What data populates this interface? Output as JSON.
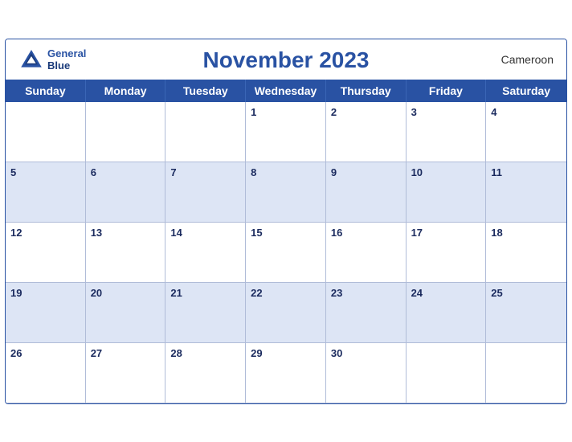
{
  "header": {
    "title": "November 2023",
    "country": "Cameroon",
    "logo_line1": "General",
    "logo_line2": "Blue"
  },
  "days": [
    "Sunday",
    "Monday",
    "Tuesday",
    "Wednesday",
    "Thursday",
    "Friday",
    "Saturday"
  ],
  "weeks": [
    [
      {
        "date": "",
        "row": "odd"
      },
      {
        "date": "",
        "row": "odd"
      },
      {
        "date": "",
        "row": "odd"
      },
      {
        "date": "1",
        "row": "odd"
      },
      {
        "date": "2",
        "row": "odd"
      },
      {
        "date": "3",
        "row": "odd"
      },
      {
        "date": "4",
        "row": "odd"
      }
    ],
    [
      {
        "date": "5",
        "row": "even"
      },
      {
        "date": "6",
        "row": "even"
      },
      {
        "date": "7",
        "row": "even"
      },
      {
        "date": "8",
        "row": "even"
      },
      {
        "date": "9",
        "row": "even"
      },
      {
        "date": "10",
        "row": "even"
      },
      {
        "date": "11",
        "row": "even"
      }
    ],
    [
      {
        "date": "12",
        "row": "odd"
      },
      {
        "date": "13",
        "row": "odd"
      },
      {
        "date": "14",
        "row": "odd"
      },
      {
        "date": "15",
        "row": "odd"
      },
      {
        "date": "16",
        "row": "odd"
      },
      {
        "date": "17",
        "row": "odd"
      },
      {
        "date": "18",
        "row": "odd"
      }
    ],
    [
      {
        "date": "19",
        "row": "even"
      },
      {
        "date": "20",
        "row": "even"
      },
      {
        "date": "21",
        "row": "even"
      },
      {
        "date": "22",
        "row": "even"
      },
      {
        "date": "23",
        "row": "even"
      },
      {
        "date": "24",
        "row": "even"
      },
      {
        "date": "25",
        "row": "even"
      }
    ],
    [
      {
        "date": "26",
        "row": "odd"
      },
      {
        "date": "27",
        "row": "odd"
      },
      {
        "date": "28",
        "row": "odd"
      },
      {
        "date": "29",
        "row": "odd"
      },
      {
        "date": "30",
        "row": "odd"
      },
      {
        "date": "",
        "row": "odd"
      },
      {
        "date": "",
        "row": "odd"
      }
    ]
  ]
}
